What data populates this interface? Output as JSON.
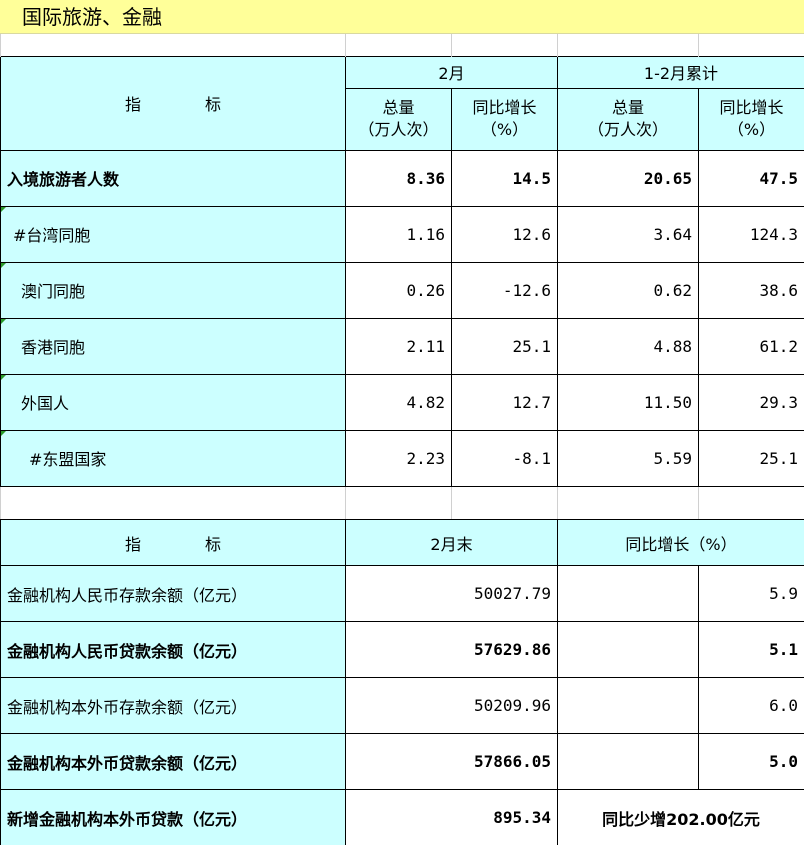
{
  "page_title": "国际旅游、金融",
  "tourism": {
    "header": {
      "indicator": "指　　　　标",
      "group1": "2月",
      "group2": "1-2月累计",
      "total_label": "总量",
      "total_unit": "（万人次）",
      "growth_label": "同比增长",
      "growth_unit": "（%）"
    },
    "rows": [
      {
        "name": "入境旅游者人数",
        "feb_total": "8.36",
        "feb_growth": "14.5",
        "cum_total": "20.65",
        "cum_growth": "47.5"
      },
      {
        "name": "#台湾同胞",
        "feb_total": "1.16",
        "feb_growth": "12.6",
        "cum_total": "3.64",
        "cum_growth": "124.3"
      },
      {
        "name": "澳门同胞",
        "feb_total": "0.26",
        "feb_growth": "-12.6",
        "cum_total": "0.62",
        "cum_growth": "38.6"
      },
      {
        "name": "香港同胞",
        "feb_total": "2.11",
        "feb_growth": "25.1",
        "cum_total": "4.88",
        "cum_growth": "61.2"
      },
      {
        "name": "外国人",
        "feb_total": "4.82",
        "feb_growth": "12.7",
        "cum_total": "11.50",
        "cum_growth": "29.3"
      },
      {
        "name": "#东盟国家",
        "feb_total": "2.23",
        "feb_growth": "-8.1",
        "cum_total": "5.59",
        "cum_growth": "25.1"
      }
    ]
  },
  "finance": {
    "header": {
      "indicator": "指　　　　标",
      "col1": "2月末",
      "col2": "同比增长（%）"
    },
    "rows": [
      {
        "name": "金融机构人民币存款余额（亿元）",
        "value": "50027.79",
        "growth": "5.9"
      },
      {
        "name": "金融机构人民币贷款余额（亿元）",
        "value": "57629.86",
        "growth": "5.1"
      },
      {
        "name": "金融机构本外币存款余额（亿元）",
        "value": "50209.96",
        "growth": "6.0"
      },
      {
        "name": "金融机构本外币贷款余额（亿元）",
        "value": "57866.05",
        "growth": "5.0"
      },
      {
        "name": "新增金融机构本外币贷款（亿元）",
        "value": "895.34",
        "growth": "同比少增202.00亿元"
      }
    ]
  }
}
